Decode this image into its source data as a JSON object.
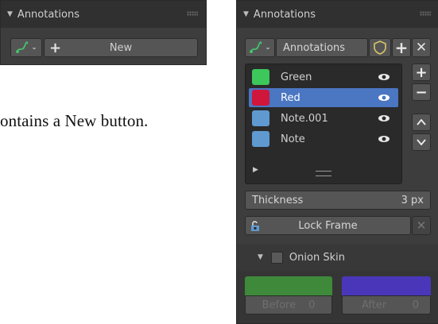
{
  "small_panel": {
    "title": "Annotations",
    "new_label": "New"
  },
  "caption": "ontains a New button.",
  "big_panel": {
    "title": "Annotations",
    "datablock_name": "Annotations",
    "layers": [
      {
        "name": "Green",
        "color": "#3cc85a",
        "selected": false
      },
      {
        "name": "Red",
        "color": "#d0163b",
        "selected": true
      },
      {
        "name": "Note.001",
        "color": "#5f99d0",
        "selected": false
      },
      {
        "name": "Note",
        "color": "#5f99d0",
        "selected": false
      }
    ],
    "thickness_label": "Thickness",
    "thickness_value": "3 px",
    "lock_frame_label": "Lock Frame",
    "onion_skin_label": "Onion Skin",
    "before_label": "Before",
    "before_value": "0",
    "after_label": "After",
    "after_value": "0",
    "before_color": "#3e8a3a",
    "after_color": "#4a36b8"
  }
}
